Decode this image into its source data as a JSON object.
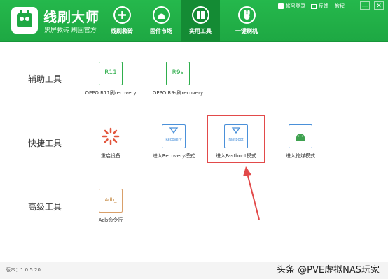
{
  "app": {
    "brand_name": "线刷大师",
    "brand_tagline": "黑屏救砖 刷回官方"
  },
  "nav": {
    "tabs": [
      {
        "label": "线刷救砖",
        "icon": "plus-circle-icon"
      },
      {
        "label": "固件市场",
        "icon": "android-icon"
      },
      {
        "label": "实用工具",
        "icon": "grid-icon",
        "active": true
      },
      {
        "label": "一键刷机",
        "icon": "rabbit-icon"
      }
    ]
  },
  "topbar": {
    "login": "帐号登录",
    "feedback": "反馈",
    "tutorial": "教程",
    "minimize": "—",
    "close": "✕"
  },
  "sections": {
    "assist": {
      "title": "辅助工具",
      "items": [
        {
          "label": "OPPO R11刷recovery",
          "icon_text": "R11"
        },
        {
          "label": "OPPO R9s刷recovery",
          "icon_text": "R9s"
        }
      ]
    },
    "quick": {
      "title": "快捷工具",
      "items": [
        {
          "label": "重启设备"
        },
        {
          "label": "进入Recovery模式",
          "icon_text": "Recovery"
        },
        {
          "label": "进入Fastboot模式",
          "icon_text": "Fastboot"
        },
        {
          "label": "进入挖煤模式"
        }
      ]
    },
    "advanced": {
      "title": "高级工具",
      "items": [
        {
          "label": "Adb命令行",
          "icon_text": "Adb_"
        }
      ]
    }
  },
  "footer": {
    "version": "版本：1.0.5.20",
    "watermark": "头条 @PVE虚拟NAS玩家"
  },
  "colors": {
    "brand_green": "#1ea843",
    "active_tab": "#148b34",
    "highlight_red": "#e24a4a"
  }
}
